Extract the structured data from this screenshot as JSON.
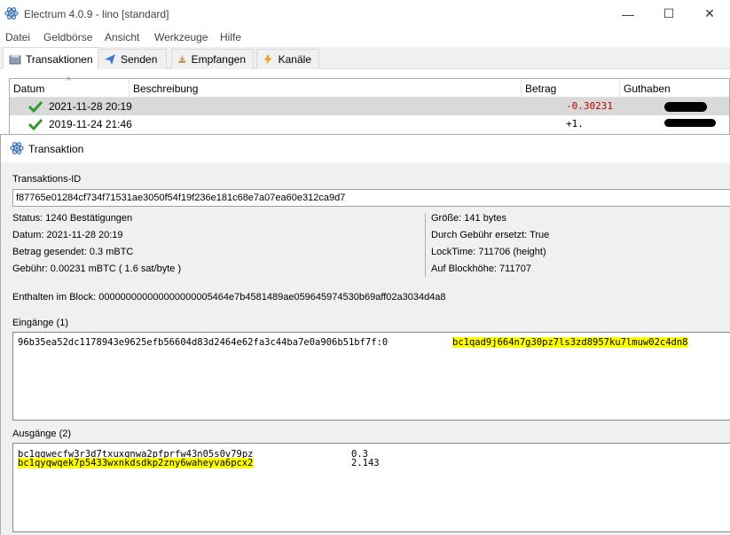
{
  "window": {
    "title": "Electrum 4.0.9  -  lino  [standard]",
    "minimize": "—",
    "maximize": "☐",
    "close": "✕"
  },
  "menu": [
    "Datei",
    "Geldbörse",
    "Ansicht",
    "Werkzeuge",
    "Hilfe"
  ],
  "tabs": [
    {
      "label": "Transaktionen",
      "icon": "history-icon"
    },
    {
      "label": "Senden",
      "icon": "send-icon"
    },
    {
      "label": "Empfangen",
      "icon": "receive-icon"
    },
    {
      "label": "Kanäle",
      "icon": "lightning-icon"
    }
  ],
  "history": {
    "columns": [
      "Datum",
      "Beschreibung",
      "Betrag",
      "Guthaben"
    ],
    "rows": [
      {
        "date": "2021-11-28 20:19",
        "description": "",
        "amount": "-0.30231",
        "balance": ""
      },
      {
        "date": "2019-11-24 21:46",
        "description": "",
        "amount": "+1.",
        "balance": ""
      }
    ]
  },
  "dialog": {
    "title": "Transaktion",
    "txid_label": "Transaktions-ID",
    "txid": "f87765e01284cf734f71531ae3050f54f19f236e181c68e7a07ea60e312ca9d7",
    "status": "Status: 1240 Bestätigungen",
    "date": "Datum: 2021-11-28 20:19",
    "amount_sent": "Betrag gesendet: 0.3 mBTC",
    "fee": "Gebühr: 0.00231 mBTC  ( 1.6 sat/byte )",
    "size": "Größe: 141 bytes",
    "rbf": "Durch Gebühr ersetzt: True",
    "locktime": "LockTime: 711706 (height)",
    "block_height": "Auf Blockhöhe: 711707",
    "block": "Enthalten im Block: 000000000000000000005464e7b4581489ae059645974530b69aff02a3034d4a8",
    "inputs_label": "Eingänge (1)",
    "inputs": [
      {
        "outpoint": "96b35ea52dc1178943e9625efb56604d83d2464e62fa3c44ba7e0a906b51bf7f:0",
        "address": "bc1qad9j664n7g30pz7ls3zd8957ku7lmuw02c4dn8"
      }
    ],
    "outputs_label": "Ausgänge (2)",
    "outputs": [
      {
        "address": "bc1qgwecfw3r3d7txuxqnwa2pfprfw43n05s0v79pz",
        "amount": "0.3"
      },
      {
        "address": "bc1qyqwqek7p5433wxnkdsdkp2zny6waheyva6pcx2",
        "amount": "2.143"
      }
    ]
  }
}
